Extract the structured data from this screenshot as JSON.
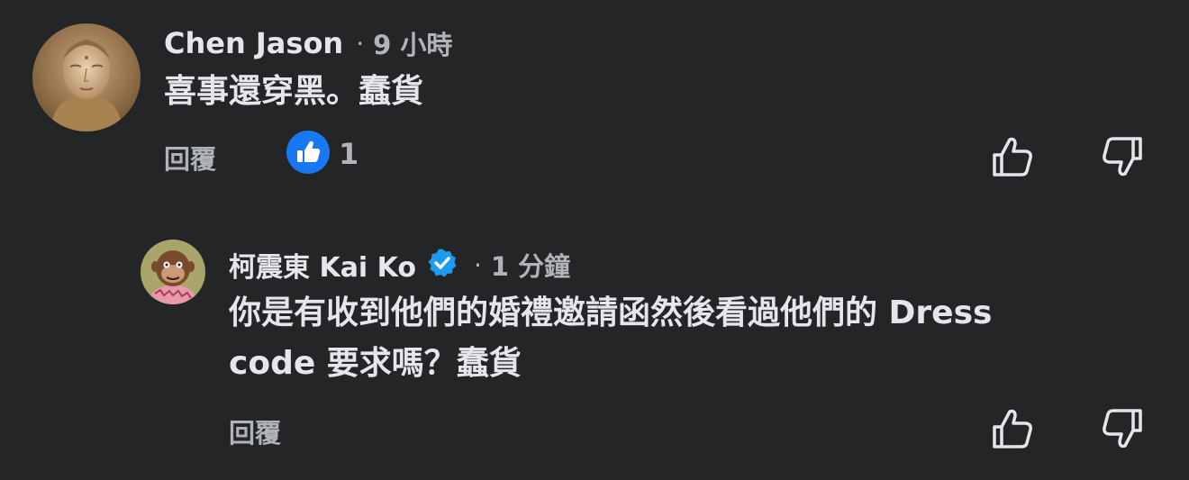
{
  "comments": [
    {
      "author": "Chen Jason",
      "separator": "·",
      "time": "9 小時",
      "text": "喜事還穿黑。蠢貨",
      "reply_label": "回覆",
      "reaction_count": "1",
      "reaction_icon": "like-reaction-icon"
    },
    {
      "author": "柯震東 Kai Ko",
      "verified": true,
      "separator": "·",
      "time": "1 分鐘",
      "text_line1": "你是有收到他們的婚禮邀請函然後看過他們的 Dress",
      "text_line2": "code 要求嗎？蠢貨",
      "reply_label": "回覆"
    }
  ],
  "colors": {
    "background": "#242526",
    "text_primary": "#e4e6eb",
    "text_secondary": "#b0b3b8",
    "like_blue": "#1877f2",
    "verified_blue": "#1d9bf0"
  }
}
